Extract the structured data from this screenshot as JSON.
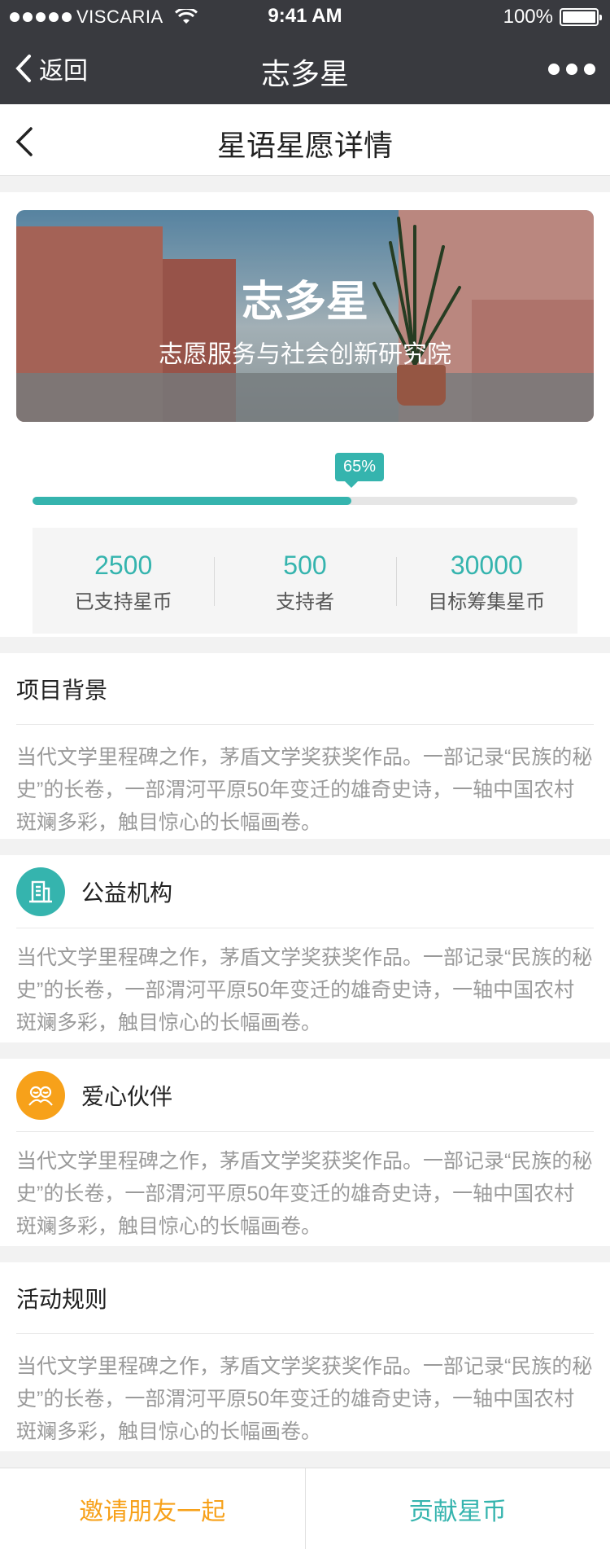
{
  "status_bar": {
    "carrier": "VISCARIA",
    "time": "9:41 AM",
    "battery": "100%"
  },
  "nav": {
    "back_label": "返回",
    "title": "志多星"
  },
  "page": {
    "title": "星语星愿详情"
  },
  "banner": {
    "title": "志多星",
    "subtitle": "志愿服务与社会创新研究院"
  },
  "progress": {
    "label": "65%",
    "value": 0.65
  },
  "stats": [
    {
      "value": "2500",
      "label": "已支持星币"
    },
    {
      "value": "500",
      "label": "支持者"
    },
    {
      "value": "30000",
      "label": "目标筹集星币"
    }
  ],
  "sections": {
    "background": {
      "title": "项目背景",
      "body": "当代文学里程碑之作，茅盾文学奖获奖作品。一部记录“民族的秘史”的长卷，一部渭河平原50年变迁的雄奇史诗，一轴中国农村斑斓多彩，触目惊心的长幅画卷。"
    },
    "organization": {
      "title": "公益机构",
      "icon": "building-icon",
      "icon_color": "#35b4ae",
      "body": "当代文学里程碑之作，茅盾文学奖获奖作品。一部记录“民族的秘史”的长卷，一部渭河平原50年变迁的雄奇史诗，一轴中国农村斑斓多彩，触目惊心的长幅画卷。"
    },
    "partner": {
      "title": "爱心伙伴",
      "icon": "partners-icon",
      "icon_color": "#f7a11a",
      "body": "当代文学里程碑之作，茅盾文学奖获奖作品。一部记录“民族的秘史”的长卷，一部渭河平原50年变迁的雄奇史诗，一轴中国农村斑斓多彩，触目惊心的长幅画卷。"
    },
    "rules": {
      "title": "活动规则",
      "body": "当代文学里程碑之作，茅盾文学奖获奖作品。一部记录“民族的秘史”的长卷，一部渭河平原50年变迁的雄奇史诗，一轴中国农村斑斓多彩，触目惊心的长幅画卷。"
    }
  },
  "actions": {
    "invite_label": "邀请朋友一起",
    "contribute_label": "贡献星币"
  },
  "colors": {
    "accent": "#35b4ae",
    "orange": "#f7a11a",
    "nav_bg": "#393a3f"
  }
}
